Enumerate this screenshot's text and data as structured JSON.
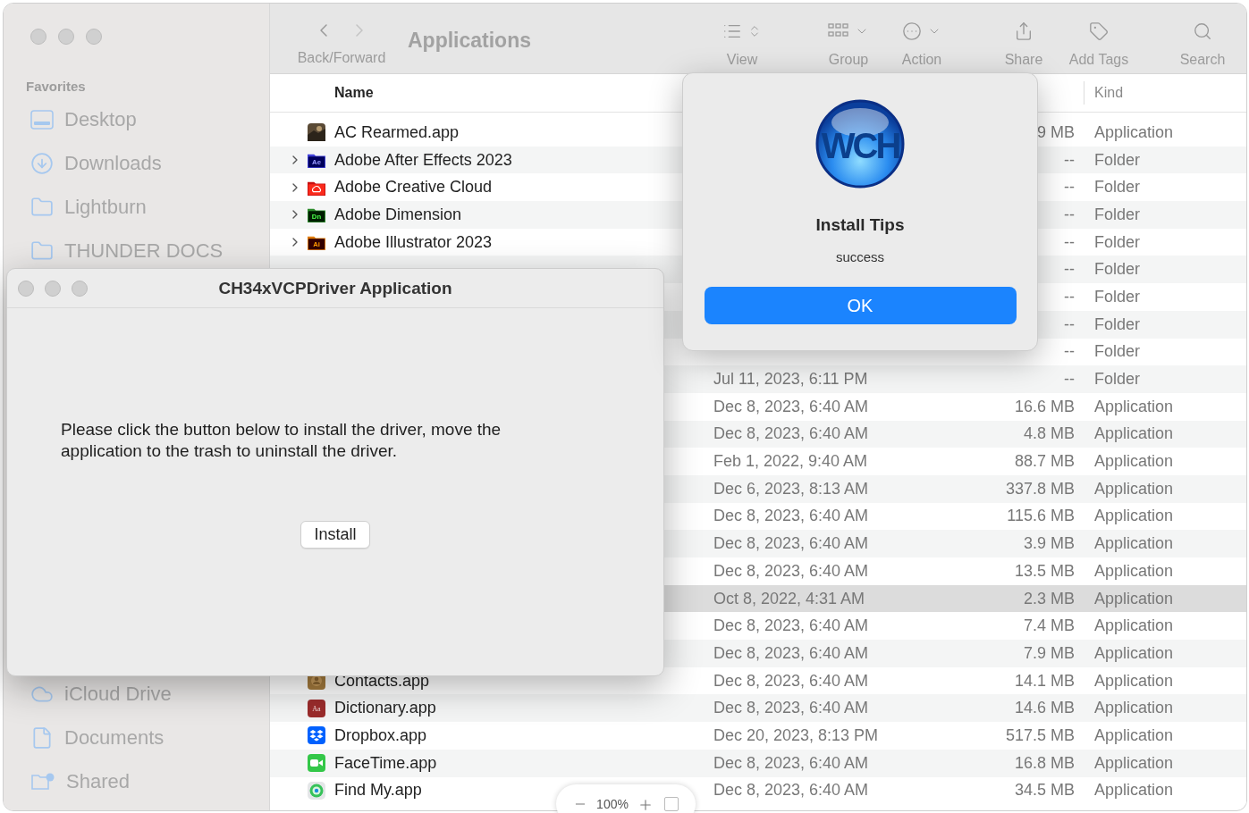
{
  "finder": {
    "toolbar": {
      "nav_label": "Back/Forward",
      "title": "Applications",
      "tools": [
        {
          "kind": "view",
          "label": "View"
        },
        {
          "kind": "group",
          "label": "Group"
        },
        {
          "kind": "action",
          "label": "Action"
        },
        {
          "kind": "share",
          "label": "Share"
        },
        {
          "kind": "tags",
          "label": "Add Tags"
        },
        {
          "kind": "search",
          "label": "Search"
        }
      ]
    },
    "sidebar": {
      "section": "Favorites",
      "top_items": [
        {
          "kind": "desktop",
          "label": "Desktop"
        },
        {
          "kind": "downloads",
          "label": "Downloads"
        },
        {
          "kind": "folder",
          "label": "Lightburn"
        },
        {
          "kind": "folder",
          "label": "THUNDER DOCS"
        }
      ],
      "bottom_items": [
        {
          "kind": "cloud",
          "label": "iCloud Drive"
        },
        {
          "kind": "document",
          "label": "Documents"
        },
        {
          "kind": "shared",
          "label": "Shared"
        }
      ]
    },
    "columns": {
      "name": "Name",
      "kind": "Kind"
    },
    "rows": [
      {
        "kind": "game",
        "name": "AC Rearmed.app",
        "expandable": false,
        "size": "9 MB",
        "type": "Application",
        "selected": false
      },
      {
        "kind": "ae",
        "icon_text": "Ae",
        "name": "Adobe After Effects 2023",
        "expandable": true,
        "size": "--",
        "type": "Folder",
        "selected": false
      },
      {
        "kind": "cc",
        "name": "Adobe Creative Cloud",
        "expandable": true,
        "size": "--",
        "type": "Folder",
        "selected": false
      },
      {
        "kind": "dn",
        "icon_text": "Dn",
        "name": "Adobe Dimension",
        "expandable": true,
        "size": "--",
        "type": "Folder",
        "selected": false
      },
      {
        "kind": "ai",
        "icon_text": "Ai",
        "name": "Adobe Illustrator 2023",
        "expandable": true,
        "size": "--",
        "type": "Folder",
        "selected": false
      },
      {
        "kind": "covered",
        "expandable": false,
        "size": "--",
        "type": "Folder",
        "selected": false
      },
      {
        "kind": "covered",
        "expandable": false,
        "size": "--",
        "type": "Folder",
        "selected": false
      },
      {
        "kind": "covered",
        "expandable": false,
        "size": "--",
        "type": "Folder",
        "selected": false
      },
      {
        "kind": "covered",
        "expandable": false,
        "size": "--",
        "type": "Folder",
        "selected": false
      },
      {
        "kind": "covered",
        "expandable": false,
        "date": "Jul 11, 2023, 6:11 PM",
        "size": "--",
        "type": "Folder",
        "selected": false
      },
      {
        "kind": "covered",
        "expandable": false,
        "date": "Dec 8, 2023, 6:40 AM",
        "size": "16.6 MB",
        "type": "Application",
        "selected": false
      },
      {
        "kind": "covered",
        "expandable": false,
        "date": "Dec 8, 2023, 6:40 AM",
        "size": "4.8 MB",
        "type": "Application",
        "selected": false
      },
      {
        "kind": "covered",
        "expandable": false,
        "date": "Feb 1, 2022, 9:40 AM",
        "size": "88.7 MB",
        "type": "Application",
        "selected": false
      },
      {
        "kind": "covered",
        "expandable": false,
        "date": "Dec 6, 2023, 8:13 AM",
        "size": "337.8 MB",
        "type": "Application",
        "selected": false
      },
      {
        "kind": "covered",
        "expandable": false,
        "date": "Dec 8, 2023, 6:40 AM",
        "size": "115.6 MB",
        "type": "Application",
        "selected": false
      },
      {
        "kind": "covered",
        "expandable": false,
        "date": "Dec 8, 2023, 6:40 AM",
        "size": "3.9 MB",
        "type": "Application",
        "selected": false
      },
      {
        "kind": "covered",
        "expandable": false,
        "date": "Dec 8, 2023, 6:40 AM",
        "size": "13.5 MB",
        "type": "Application",
        "selected": false
      },
      {
        "kind": "covered",
        "expandable": false,
        "date": "Oct 8, 2022, 4:31 AM",
        "size": "2.3 MB",
        "type": "Application",
        "selected": true
      },
      {
        "kind": "covered",
        "expandable": false,
        "date": "Dec 8, 2023, 6:40 AM",
        "size": "7.4 MB",
        "type": "Application",
        "selected": false
      },
      {
        "kind": "covered",
        "expandable": false,
        "date": "Dec 8, 2023, 6:40 AM",
        "size": "7.9 MB",
        "type": "Application",
        "selected": false
      },
      {
        "kind": "contacts",
        "name": "Contacts.app",
        "expandable": false,
        "date": "Dec 8, 2023, 6:40 AM",
        "size": "14.1 MB",
        "type": "Application",
        "selected": false
      },
      {
        "kind": "dictionary",
        "icon_text": "Aa",
        "name": "Dictionary.app",
        "expandable": false,
        "date": "Dec 8, 2023, 6:40 AM",
        "size": "14.6 MB",
        "type": "Application",
        "selected": false
      },
      {
        "kind": "dropbox",
        "name": "Dropbox.app",
        "expandable": false,
        "date": "Dec 20, 2023, 8:13 PM",
        "size": "517.5 MB",
        "type": "Application",
        "selected": false
      },
      {
        "kind": "facetime",
        "name": "FaceTime.app",
        "expandable": false,
        "date": "Dec 8, 2023, 6:40 AM",
        "size": "16.8 MB",
        "type": "Application",
        "selected": false
      },
      {
        "kind": "findmy",
        "name": "Find My.app",
        "expandable": false,
        "date": "Dec 8, 2023, 6:40 AM",
        "size": "34.5 MB",
        "type": "Application",
        "selected": false
      }
    ],
    "zoom": {
      "value": "100%"
    }
  },
  "driver_window": {
    "title": "CH34xVCPDriver Application",
    "message": "Please click the button below to install the driver, move the application to the trash to uninstall the driver.",
    "button": "Install"
  },
  "alert": {
    "logo_text": "WCH",
    "title": "Install Tips",
    "message": "success",
    "button": "OK"
  }
}
